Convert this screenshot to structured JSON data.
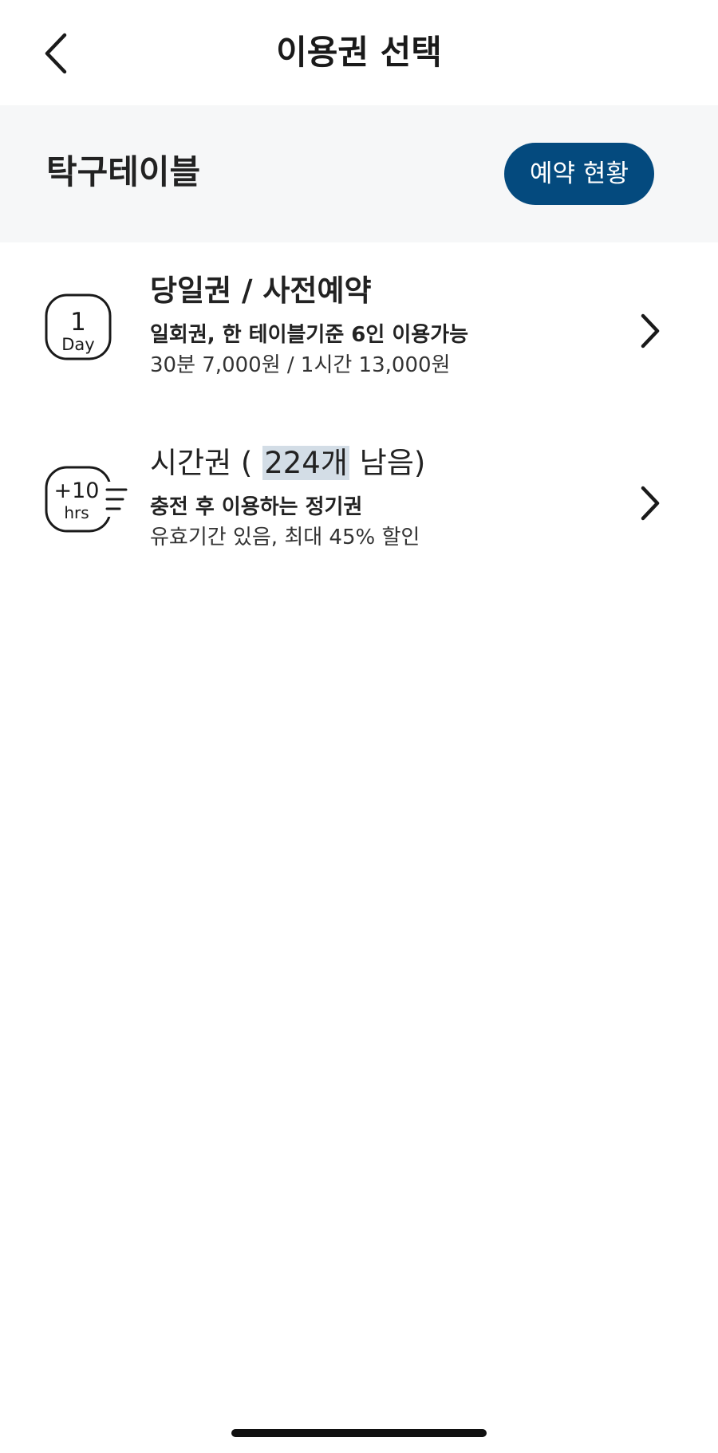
{
  "header": {
    "title": "이용권 선택",
    "back_icon": "chevron-left-icon"
  },
  "venue": {
    "name": "탁구테이블",
    "reservation_button_label": "예약 현황",
    "accent_color": "#044a7e"
  },
  "tickets": [
    {
      "icon": "one-day-icon",
      "icon_number": "1",
      "icon_unit": "Day",
      "title": "당일권 / 사전예약",
      "description": "일회권, 한 테이블기준 6인 이용가능",
      "price": "30분 7,000원 / 1시간 13,000원"
    },
    {
      "icon": "plus-ten-hours-icon",
      "icon_number": "+10",
      "icon_unit": "hrs",
      "title_prefix": "시간권 (",
      "title_remaining": "224개",
      "title_suffix": "남음)",
      "description": "충전 후 이용하는 정기권",
      "price": "유효기간 있음, 최대 45% 할인"
    }
  ]
}
